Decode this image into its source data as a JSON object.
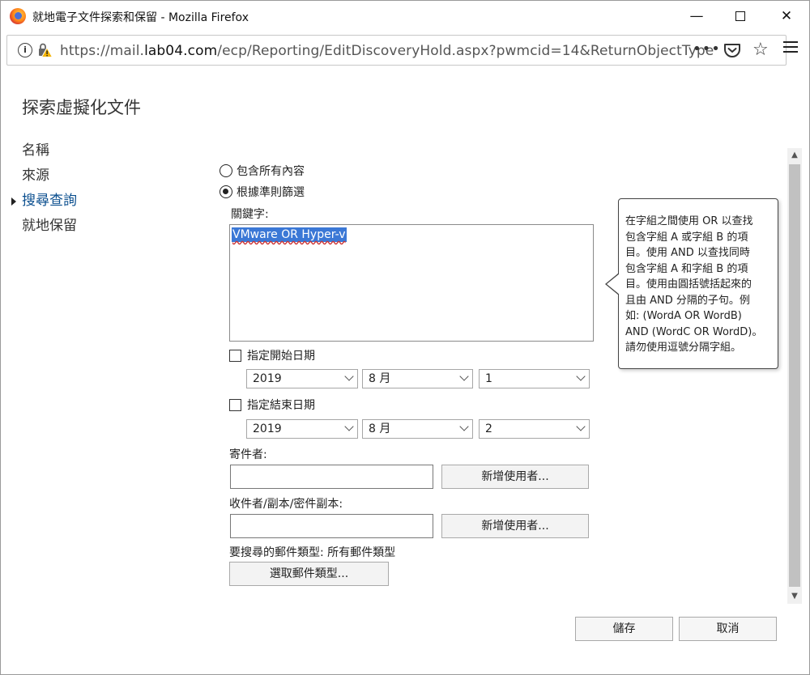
{
  "window": {
    "title": "就地電子文件探索和保留 - Mozilla Firefox",
    "minimize_glyph": "—",
    "close_glyph": "✕"
  },
  "urlbar": {
    "prefix": "https://mail.",
    "domain": "lab04.com",
    "path": "/ecp/Reporting/EditDiscoveryHold.aspx?pwmcid=14&ReturnObjectType",
    "overflow": "•••",
    "info_glyph": "i",
    "star_glyph": "☆"
  },
  "page": {
    "title": "探索虛擬化文件"
  },
  "nav": {
    "items": [
      {
        "label": "名稱"
      },
      {
        "label": "來源"
      },
      {
        "label": "搜尋查詢"
      },
      {
        "label": "就地保留"
      }
    ],
    "active_index": 2
  },
  "filter": {
    "option_all": "包含所有內容",
    "option_criteria": "根據準則篩選",
    "selected": "option_criteria"
  },
  "keywords": {
    "label": "關鍵字:",
    "value": "VMware OR Hyper-v"
  },
  "start_date": {
    "label": "指定開始日期",
    "checked": false,
    "year": "2019",
    "month": "8 月",
    "day": "1"
  },
  "end_date": {
    "label": "指定結束日期",
    "checked": false,
    "year": "2019",
    "month": "8 月",
    "day": "2"
  },
  "sender": {
    "label": "寄件者:",
    "value": "",
    "add_button": "新增使用者..."
  },
  "recipients": {
    "label": "收件者/副本/密件副本:",
    "value": "",
    "add_button": "新增使用者..."
  },
  "message_types": {
    "label": "要搜尋的郵件類型: 所有郵件類型",
    "select_button": "選取郵件類型..."
  },
  "tooltip": {
    "text": "在字組之間使用 OR 以查找\n包含字組 A 或字組 B 的項\n目。使用 AND 以查找同時\n包含字組 A 和字組 B 的項\n目。使用由圓括號括起來的\n且由 AND 分隔的子句。例\n如: (WordA OR WordB)\nAND (WordC OR WordD)。\n請勿使用逗號分隔字組。"
  },
  "footer": {
    "save": "儲存",
    "cancel": "取消"
  },
  "colors": {
    "accent": "#0b4f8f",
    "selection": "#3b78d6"
  }
}
